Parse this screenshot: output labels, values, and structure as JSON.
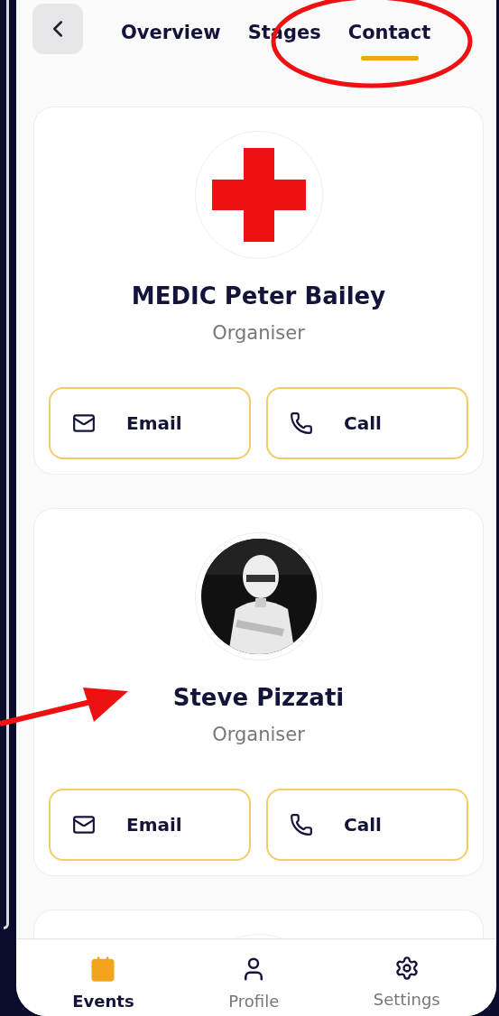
{
  "tabs": [
    {
      "label": "Overview",
      "selected": false
    },
    {
      "label": "Stages",
      "selected": false
    },
    {
      "label": "Contact",
      "selected": true
    }
  ],
  "contacts": [
    {
      "name": "MEDIC Peter Bailey",
      "role": "Organiser",
      "kind": "cross",
      "actions": [
        {
          "kind": "email",
          "label": "Email"
        },
        {
          "kind": "call",
          "label": "Call"
        }
      ]
    },
    {
      "name": "Steve Pizzati",
      "role": "Organiser",
      "kind": "picture",
      "actions": [
        {
          "kind": "email",
          "label": "Email"
        },
        {
          "kind": "call",
          "label": "Call"
        }
      ]
    },
    {
      "kind": "frame"
    }
  ],
  "nav": [
    {
      "kind": "events",
      "label": "Events",
      "selected": true
    },
    {
      "kind": "profile",
      "label": "Profile",
      "selected": false
    },
    {
      "kind": "settings",
      "label": "Settings",
      "selected": false
    }
  ]
}
